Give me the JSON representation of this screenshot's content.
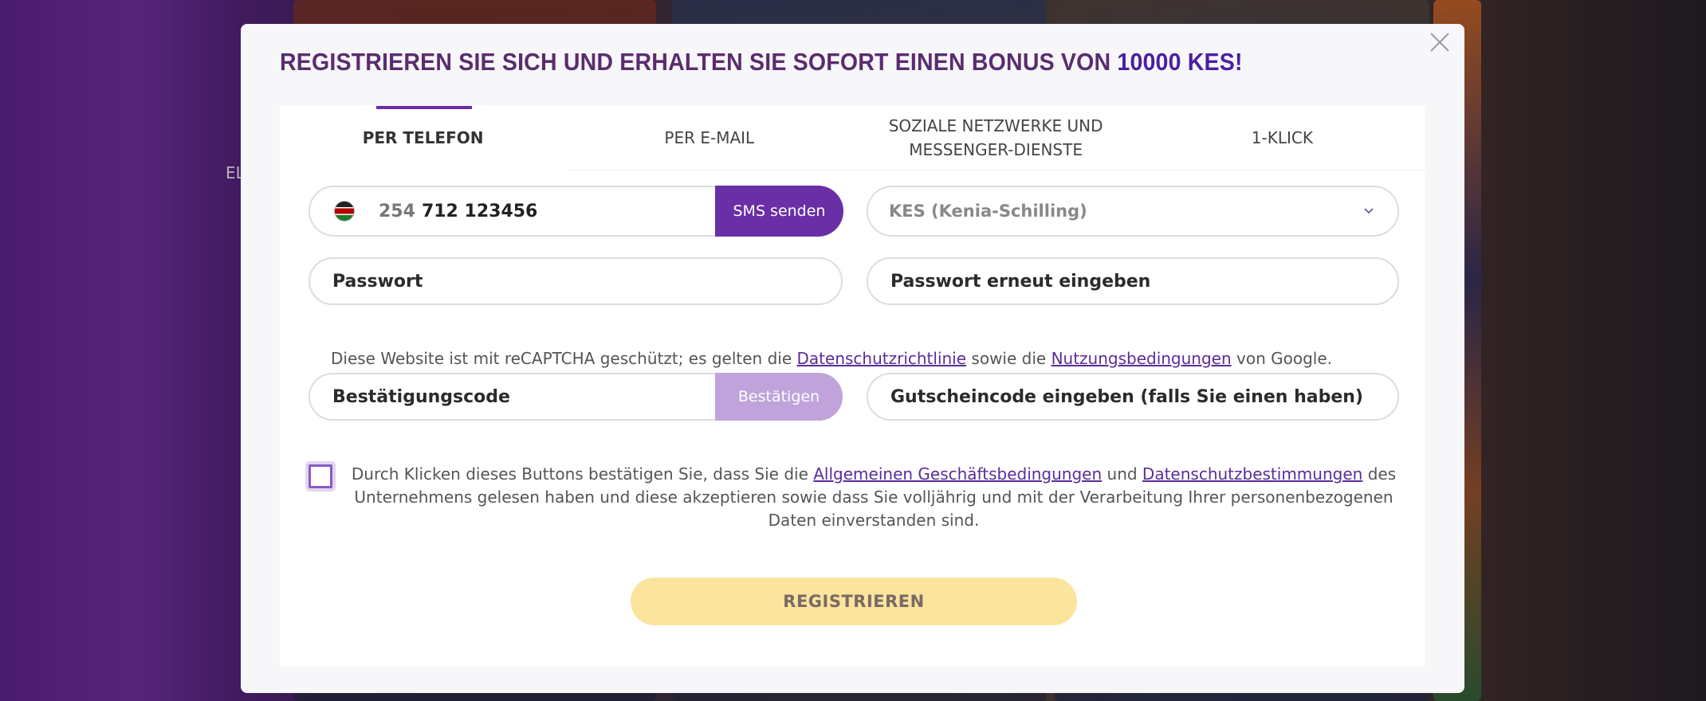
{
  "background_hint_text": "EL",
  "modal": {
    "title_main": "REGISTRIEREN SIE SICH UND ERHALTEN SIE SOFORT EINEN BONUS VON",
    "title_accent": "10000 KES!",
    "close_icon": "close-icon"
  },
  "tabs": [
    {
      "label": "PER TELEFON",
      "active": true
    },
    {
      "label": "PER E-MAIL",
      "active": false
    },
    {
      "label": "SOZIALE NETZWERKE UND MESSENGER-DIENSTE",
      "active": false
    },
    {
      "label": "1-KLICK",
      "active": false
    }
  ],
  "phone": {
    "flag_icon": "kenya-flag-icon",
    "country_code": "254",
    "number": "712 123456",
    "sms_button": "SMS senden"
  },
  "currency": {
    "selected": "KES (Kenia-Schilling)",
    "icon": "chevron-down-icon"
  },
  "password": {
    "placeholder": "Passwort"
  },
  "password_repeat": {
    "placeholder": "Passwort erneut eingeben"
  },
  "recaptcha": {
    "prefix": "Diese Website ist mit reCAPTCHA geschützt; es gelten die",
    "privacy_link": "Datenschutzrichtlinie",
    "middle": "sowie die",
    "terms_link": "Nutzungsbedingungen",
    "suffix": "von Google."
  },
  "confirmation": {
    "placeholder": "Bestätigungscode",
    "button": "Bestätigen"
  },
  "promo": {
    "placeholder": "Gutscheincode eingeben (falls Sie einen haben)"
  },
  "terms": {
    "prefix": "Durch Klicken dieses Buttons bestätigen Sie, dass Sie die",
    "agb_link": "Allgemeinen Geschäftsbedingungen",
    "and": "und",
    "privacy_link": "Datenschutzbestimmungen",
    "suffix": "des Unternehmens gelesen haben und diese akzeptieren sowie dass Sie volljährig und mit der Verarbeitung Ihrer personenbezogenen Daten einverstanden sind.",
    "checked": false
  },
  "register_button": "REGISTRIEREN",
  "colors": {
    "accent_purple": "#6a2fa6",
    "title_color": "#5a2c6f",
    "register_yellow": "#fbe49c"
  }
}
